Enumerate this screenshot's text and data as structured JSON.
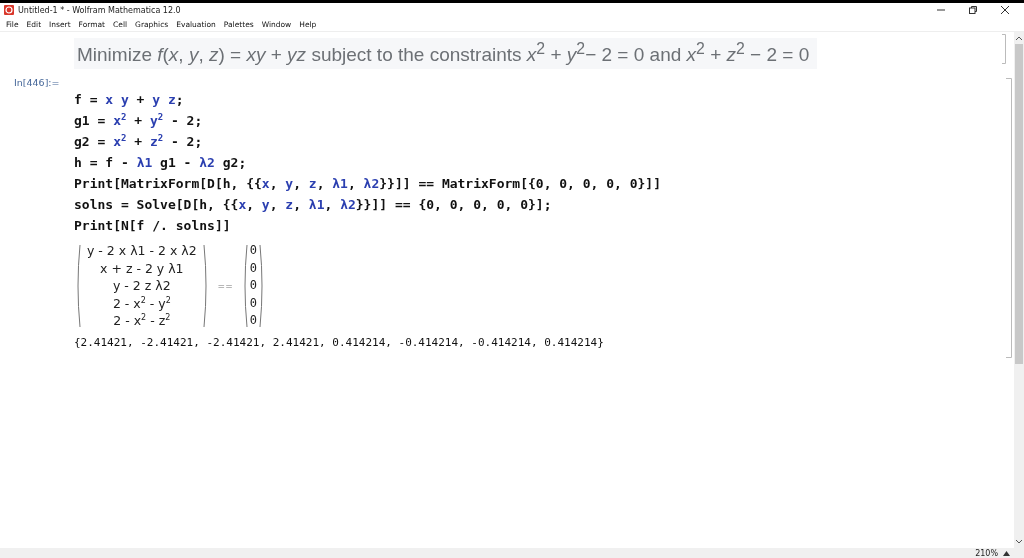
{
  "window": {
    "title": "Untitled-1 * - Wolfram Mathematica 12.0"
  },
  "menu": [
    "File",
    "Edit",
    "Insert",
    "Format",
    "Cell",
    "Graphics",
    "Evaluation",
    "Palettes",
    "Window",
    "Help"
  ],
  "problem_text": "Minimize *f*(*x*, *y*, *z*) = *xy* + *yz* subject to the constraints *x*$^{2}$ + *y*$^{2}$− 2 = 0 and *x*$^{2}$ + *z*$^{2}$ − 2 = 0",
  "input_label": "In[446]:=",
  "code_lines": [
    [
      {
        "text": "f = ",
        "kind": "sym"
      },
      {
        "text": "x y",
        "kind": "var"
      },
      {
        "text": " + ",
        "kind": "sym"
      },
      {
        "text": "y z",
        "kind": "var"
      },
      {
        "text": ";",
        "kind": "sym"
      }
    ],
    [
      {
        "text": "g1 = ",
        "kind": "sym"
      },
      {
        "text": "x$^{2}$",
        "kind": "var"
      },
      {
        "text": " + ",
        "kind": "sym"
      },
      {
        "text": "y$^{2}$",
        "kind": "var"
      },
      {
        "text": " - 2;",
        "kind": "sym"
      }
    ],
    [
      {
        "text": "g2 = ",
        "kind": "sym"
      },
      {
        "text": "x$^{2}$",
        "kind": "var"
      },
      {
        "text": " + ",
        "kind": "sym"
      },
      {
        "text": "z$^{2}$",
        "kind": "var"
      },
      {
        "text": " - 2;",
        "kind": "sym"
      }
    ],
    [
      {
        "text": "h = f - ",
        "kind": "sym"
      },
      {
        "text": "λ1",
        "kind": "var"
      },
      {
        "text": " g1 - ",
        "kind": "sym"
      },
      {
        "text": "λ2",
        "kind": "var"
      },
      {
        "text": " g2;",
        "kind": "sym"
      }
    ],
    [
      {
        "text": "Print[MatrixForm[D[h, {{",
        "kind": "sym"
      },
      {
        "text": "x",
        "kind": "var"
      },
      {
        "text": ", ",
        "kind": "sym"
      },
      {
        "text": "y",
        "kind": "var"
      },
      {
        "text": ", ",
        "kind": "sym"
      },
      {
        "text": "z",
        "kind": "var"
      },
      {
        "text": ", ",
        "kind": "sym"
      },
      {
        "text": "λ1",
        "kind": "var"
      },
      {
        "text": ", ",
        "kind": "sym"
      },
      {
        "text": "λ2",
        "kind": "var"
      },
      {
        "text": "}}]] == MatrixForm[{0, 0, 0, 0, 0}]]",
        "kind": "sym"
      }
    ],
    [
      {
        "text": "solns = Solve[D[h, {{",
        "kind": "sym"
      },
      {
        "text": "x",
        "kind": "var"
      },
      {
        "text": ", ",
        "kind": "sym"
      },
      {
        "text": "y",
        "kind": "var"
      },
      {
        "text": ", ",
        "kind": "sym"
      },
      {
        "text": "z",
        "kind": "var"
      },
      {
        "text": ", ",
        "kind": "sym"
      },
      {
        "text": "λ1",
        "kind": "var"
      },
      {
        "text": ", ",
        "kind": "sym"
      },
      {
        "text": "λ2",
        "kind": "var"
      },
      {
        "text": "}}]] == {0, 0, 0, 0, 0}];",
        "kind": "sym"
      }
    ],
    [
      {
        "text": "Print[N[f /. solns]]",
        "kind": "sym"
      }
    ]
  ],
  "matrix_rows": [
    "y - 2 x λ1 - 2 x λ2",
    "x + z - 2 y λ1",
    "y - 2 z λ2",
    "2 - x$^{2}$ - y$^{2}$",
    "2 - x$^{2}$ - z$^{2}$"
  ],
  "equals": "==",
  "zero_rows": [
    "0",
    "0",
    "0",
    "0",
    "0"
  ],
  "result": "{2.41421, -2.41421, -2.41421, 2.41421, 0.414214, -0.414214, -0.414214, 0.414214}",
  "status_bar": {
    "zoom": "210%"
  }
}
